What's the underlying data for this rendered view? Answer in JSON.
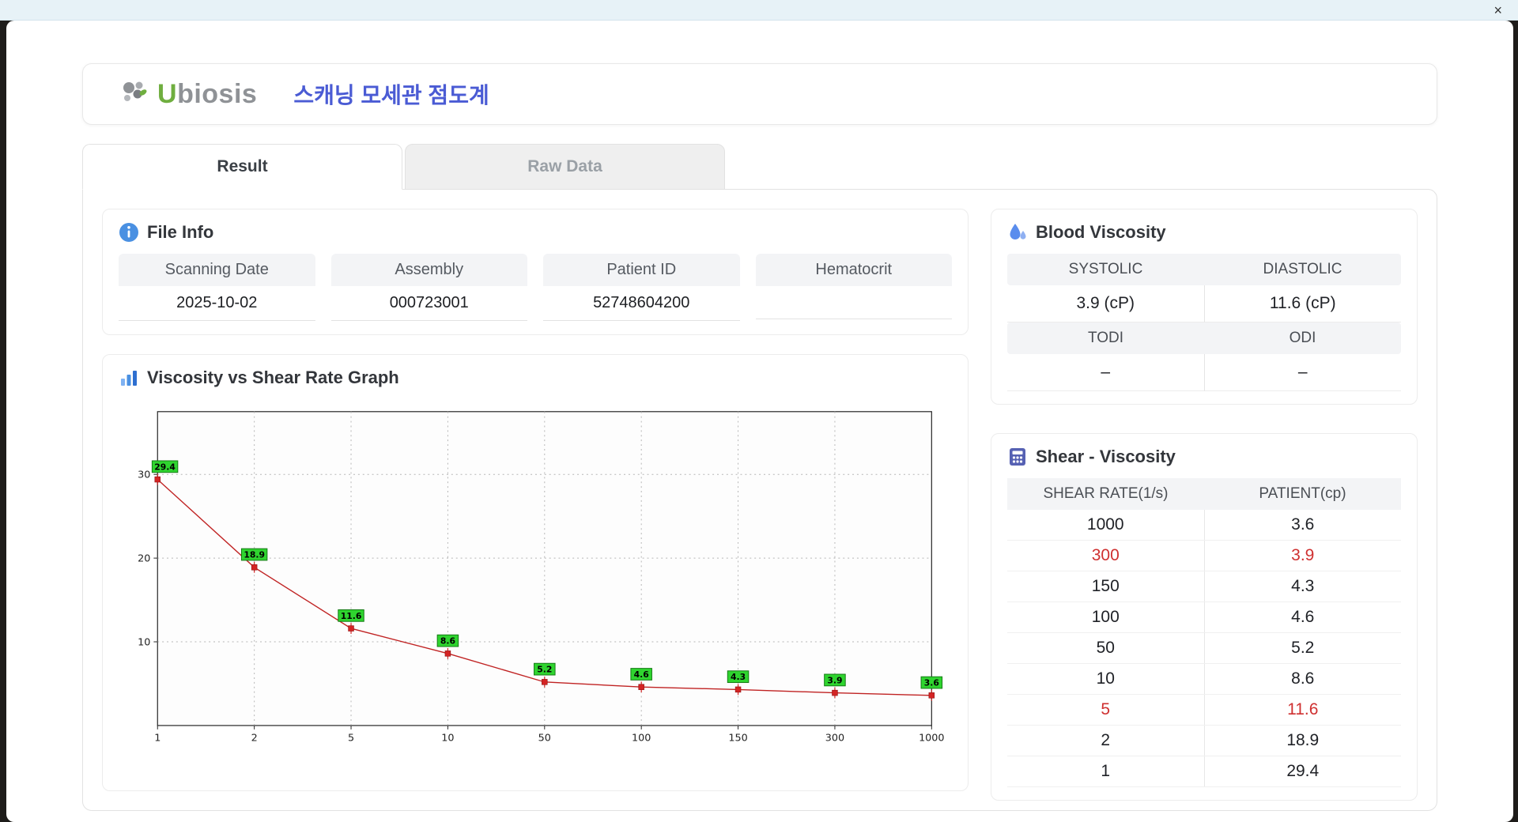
{
  "window": {
    "close_label": "×"
  },
  "header": {
    "logo_text_first": "U",
    "logo_text_rest": "biosis",
    "title": "스캐닝 모세관 점도계"
  },
  "tabs": [
    {
      "label": "Result",
      "active": true
    },
    {
      "label": "Raw Data",
      "active": false
    }
  ],
  "file_info": {
    "title": "File Info",
    "fields": [
      {
        "label": "Scanning Date",
        "value": "2025-10-02"
      },
      {
        "label": "Assembly",
        "value": "000723001"
      },
      {
        "label": "Patient ID",
        "value": "52748604200"
      },
      {
        "label": "Hematocrit",
        "value": ""
      }
    ]
  },
  "blood_viscosity": {
    "title": "Blood Viscosity",
    "rows": [
      {
        "headers": [
          "SYSTOLIC",
          "DIASTOLIC"
        ],
        "values": [
          "3.9 (cP)",
          "11.6 (cP)"
        ]
      },
      {
        "headers": [
          "TODI",
          "ODI"
        ],
        "values": [
          "–",
          "–"
        ]
      }
    ]
  },
  "shear_viscosity": {
    "title": "Shear - Viscosity",
    "columns": [
      "SHEAR RATE(1/s)",
      "PATIENT(cp)"
    ],
    "rows": [
      {
        "shear": "1000",
        "patient": "3.6",
        "highlight": false
      },
      {
        "shear": "300",
        "patient": "3.9",
        "highlight": true
      },
      {
        "shear": "150",
        "patient": "4.3",
        "highlight": false
      },
      {
        "shear": "100",
        "patient": "4.6",
        "highlight": false
      },
      {
        "shear": "50",
        "patient": "5.2",
        "highlight": false
      },
      {
        "shear": "10",
        "patient": "8.6",
        "highlight": false
      },
      {
        "shear": "5",
        "patient": "11.6",
        "highlight": true
      },
      {
        "shear": "2",
        "patient": "18.9",
        "highlight": false
      },
      {
        "shear": "1",
        "patient": "29.4",
        "highlight": false
      }
    ]
  },
  "chart_data": {
    "type": "line",
    "title": "Viscosity vs Shear Rate Graph",
    "x": [
      "1",
      "2",
      "5",
      "10",
      "50",
      "100",
      "150",
      "300",
      "1000"
    ],
    "values": [
      29.4,
      18.9,
      11.6,
      8.6,
      5.2,
      4.6,
      4.3,
      3.9,
      3.6
    ],
    "xlabel": "",
    "ylabel": "",
    "x_scale": "category",
    "yticks": [
      10,
      20,
      30
    ],
    "ylim": [
      0,
      37.5
    ],
    "grid": true,
    "legend": "none",
    "line_color": "#c02323",
    "marker_color": "#d42424",
    "label_bg": "#2fd42f",
    "label_border": "#147a14"
  },
  "colors": {
    "accent_blue": "#4a5bd4",
    "highlight_red": "#cf3030",
    "logo_green": "#6fae3f",
    "icon_blue": "#4a90e2",
    "icon_indigo": "#5661b3"
  }
}
